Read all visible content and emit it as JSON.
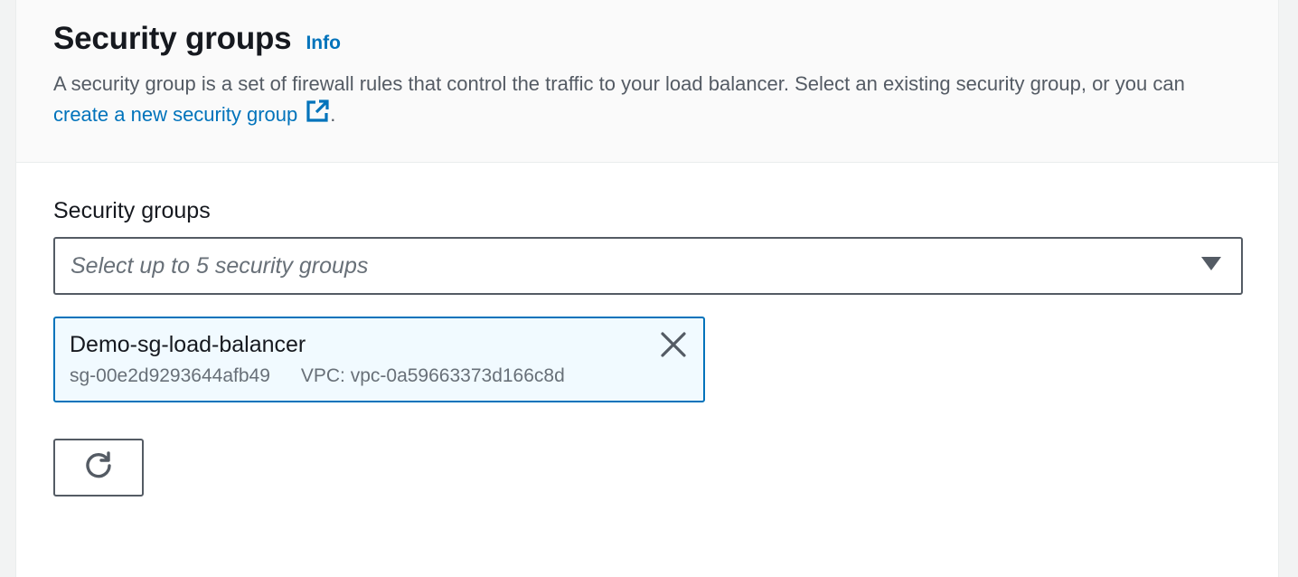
{
  "header": {
    "title": "Security groups",
    "info_label": "Info",
    "description_prefix": "A security group is a set of firewall rules that control the traffic to your load balancer. Select an existing security group, or you can ",
    "description_link": "create a new security group",
    "description_suffix": "."
  },
  "field": {
    "label": "Security groups",
    "placeholder": "Select up to 5 security groups"
  },
  "selected_groups": [
    {
      "name": "Demo-sg-load-balancer",
      "id": "sg-00e2d9293644afb49",
      "vpc": "VPC: vpc-0a59663373d166c8d"
    }
  ],
  "icons": {
    "external_link": "external-link-icon",
    "dropdown": "caret-down-icon",
    "remove": "close-icon",
    "refresh": "refresh-icon"
  },
  "colors": {
    "link": "#0073bb",
    "text": "#16191f",
    "secondary_text": "#687078",
    "token_bg": "#f1faff",
    "border": "#545b64"
  }
}
